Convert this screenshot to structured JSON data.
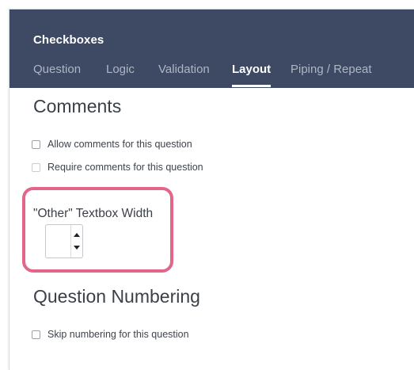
{
  "header": {
    "title": "Checkboxes",
    "tabs": [
      {
        "label": "Question",
        "active": false
      },
      {
        "label": "Logic",
        "active": false
      },
      {
        "label": "Validation",
        "active": false
      },
      {
        "label": "Layout",
        "active": true
      },
      {
        "label": "Piping / Repeat",
        "active": false
      }
    ]
  },
  "comments": {
    "heading": "Comments",
    "options": [
      {
        "label": "Allow comments for this question",
        "checked": false,
        "enabled": true
      },
      {
        "label": "Require comments for this question",
        "checked": false,
        "enabled": false
      }
    ]
  },
  "other_textbox": {
    "label": "\"Other\" Textbox Width",
    "value": "",
    "highlight_color": "#e26689"
  },
  "question_numbering": {
    "heading": "Question Numbering",
    "options": [
      {
        "label": "Skip numbering for this question",
        "checked": false,
        "enabled": true
      }
    ]
  },
  "colors": {
    "header_bg": "#3e4a63",
    "tab_inactive": "#aeb6c6",
    "tab_active": "#ffffff"
  }
}
